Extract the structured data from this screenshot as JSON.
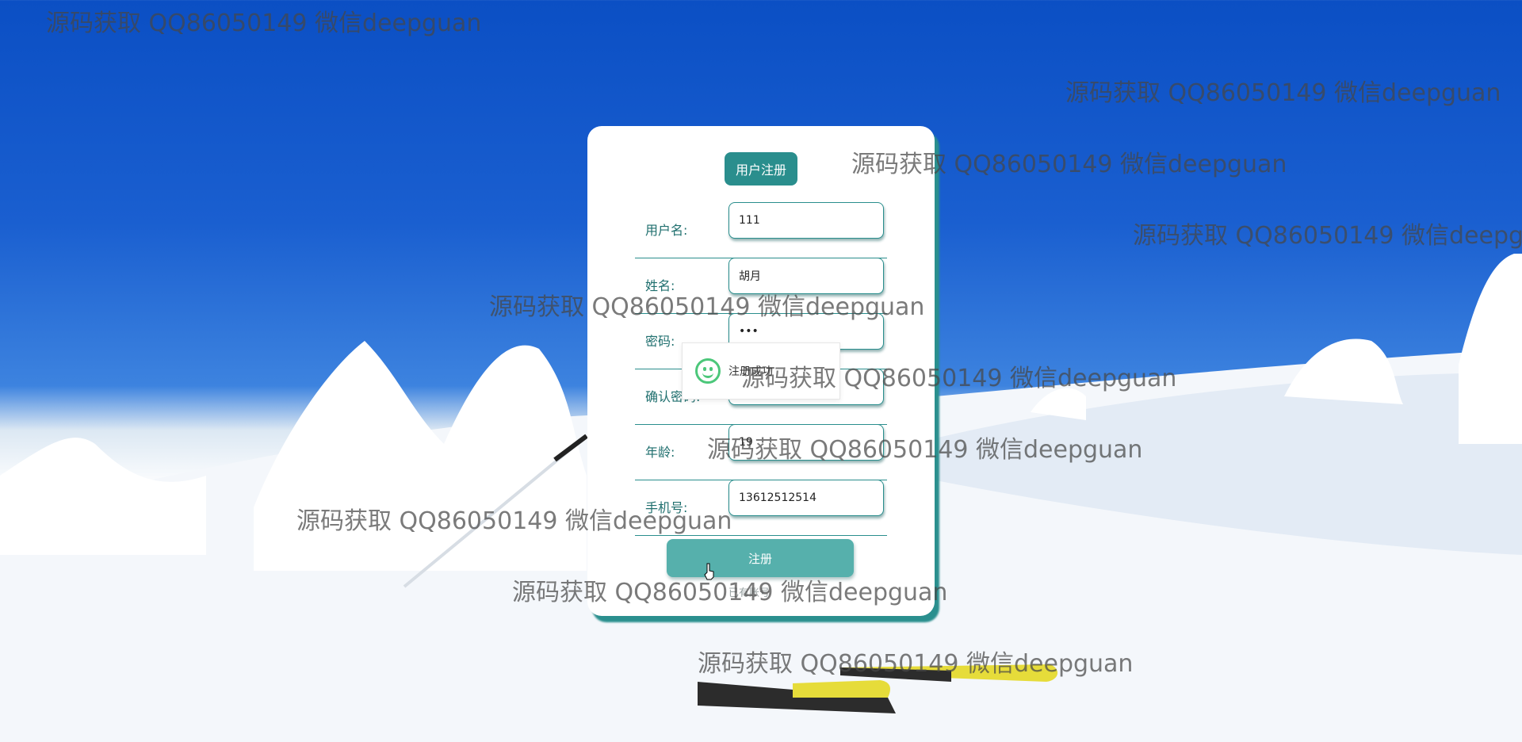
{
  "form": {
    "title": "用户注册",
    "fields": [
      {
        "label": "用户名:",
        "value": "111"
      },
      {
        "label": "姓名:",
        "value": "胡月"
      },
      {
        "label": "密码:",
        "value": "•••"
      },
      {
        "label": "确认密码:",
        "value": ""
      },
      {
        "label": "年龄:",
        "value": "19"
      },
      {
        "label": "手机号:",
        "value": "13612512514"
      }
    ],
    "submit_label": "注册",
    "login_link": "已有账号"
  },
  "toast": {
    "icon": "smile-icon",
    "message": "注册成功"
  },
  "watermark": {
    "text": "源码获取 QQ86050149 微信deepguan"
  },
  "colors": {
    "accent": "#2a8e8d",
    "submit": "#56b0ac",
    "success": "#4cc77a"
  }
}
